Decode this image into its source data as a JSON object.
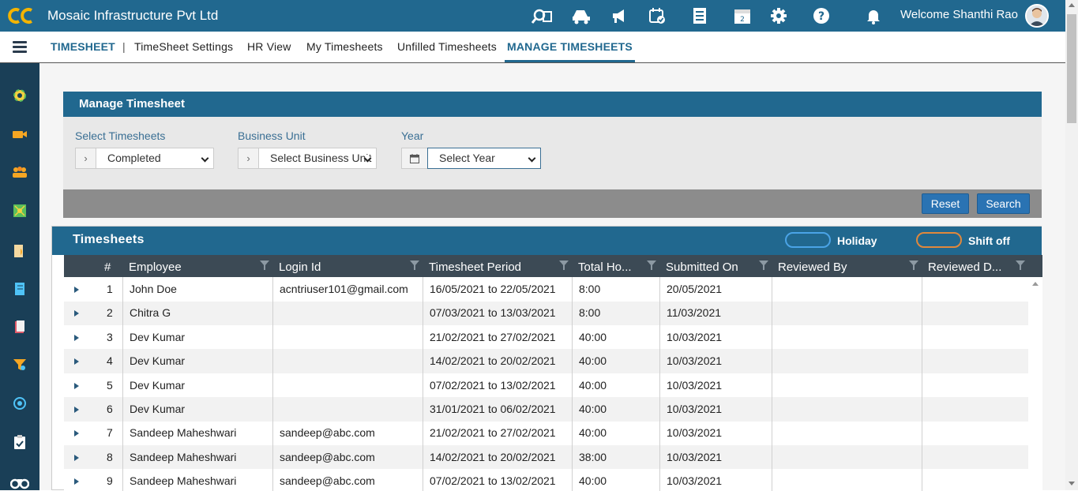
{
  "app": {
    "title": "Mosaic Infrastructure Pvt Ltd",
    "welcome": "Welcome Shanthi Rao"
  },
  "top_icons": [
    "search-people-icon",
    "vehicle-icon",
    "announcement-icon",
    "calendar-check-icon",
    "list-icon",
    "calendar-icon",
    "gear-icon",
    "help-icon",
    "bell-icon"
  ],
  "nav": {
    "brand": "TIMESHEET",
    "separator": "|",
    "items": [
      "TimeSheet Settings",
      "HR View",
      "My Timesheets",
      "Unfilled Timesheets",
      "MANAGE TIMESHEETS"
    ]
  },
  "sidebar_icons": [
    "dashboard-icon",
    "video-icon",
    "team-icon",
    "puzzle-icon",
    "document-icon",
    "notebook-icon",
    "book-icon",
    "filter-icon",
    "target-icon",
    "clipboard-icon",
    "binoculars-icon"
  ],
  "panel": {
    "title": "Manage Timesheet",
    "select_timesheets": {
      "label": "Select Timesheets",
      "value": "Completed"
    },
    "business_unit": {
      "label": "Business Unit",
      "value": "Select Business Unit"
    },
    "year": {
      "label": "Year",
      "value": "Select Year"
    },
    "reset_label": "Reset",
    "search_label": "Search"
  },
  "grid": {
    "title": "Timesheets",
    "legend_holiday": "Holiday",
    "legend_shift_off": "Shift off",
    "columns": [
      "#",
      "Employee",
      "Login Id",
      "Timesheet Period",
      "Total Ho...",
      "Submitted On",
      "Reviewed By",
      "Reviewed D..."
    ],
    "rows": [
      {
        "num": "1",
        "employee": "John Doe",
        "login": "acntriuser101@gmail.com",
        "period": "16/05/2021 to 22/05/2021",
        "hours": "8:00",
        "submitted": "20/05/2021",
        "reviewed_by": "",
        "reviewed_date": ""
      },
      {
        "num": "2",
        "employee": "Chitra G",
        "login": "",
        "period": "07/03/2021 to 13/03/2021",
        "hours": "8:00",
        "submitted": "11/03/2021",
        "reviewed_by": "",
        "reviewed_date": ""
      },
      {
        "num": "3",
        "employee": "Dev Kumar",
        "login": "",
        "period": "21/02/2021 to 27/02/2021",
        "hours": "40:00",
        "submitted": "10/03/2021",
        "reviewed_by": "",
        "reviewed_date": ""
      },
      {
        "num": "4",
        "employee": "Dev Kumar",
        "login": "",
        "period": "14/02/2021 to 20/02/2021",
        "hours": "40:00",
        "submitted": "10/03/2021",
        "reviewed_by": "",
        "reviewed_date": ""
      },
      {
        "num": "5",
        "employee": "Dev Kumar",
        "login": "",
        "period": "07/02/2021 to 13/02/2021",
        "hours": "40:00",
        "submitted": "10/03/2021",
        "reviewed_by": "",
        "reviewed_date": ""
      },
      {
        "num": "6",
        "employee": "Dev Kumar",
        "login": "",
        "period": "31/01/2021 to 06/02/2021",
        "hours": "40:00",
        "submitted": "10/03/2021",
        "reviewed_by": "",
        "reviewed_date": ""
      },
      {
        "num": "7",
        "employee": "Sandeep Maheshwari",
        "login": "sandeep@abc.com",
        "period": "21/02/2021 to 27/02/2021",
        "hours": "40:00",
        "submitted": "10/03/2021",
        "reviewed_by": "",
        "reviewed_date": ""
      },
      {
        "num": "8",
        "employee": "Sandeep Maheshwari",
        "login": "sandeep@abc.com",
        "period": "14/02/2021 to 20/02/2021",
        "hours": "38:00",
        "submitted": "10/03/2021",
        "reviewed_by": "",
        "reviewed_date": ""
      },
      {
        "num": "9",
        "employee": "Sandeep Maheshwari",
        "login": "sandeep@abc.com",
        "period": "07/02/2021 to 13/02/2021",
        "hours": "40:00",
        "submitted": "10/03/2021",
        "reviewed_by": "",
        "reviewed_date": ""
      }
    ]
  }
}
